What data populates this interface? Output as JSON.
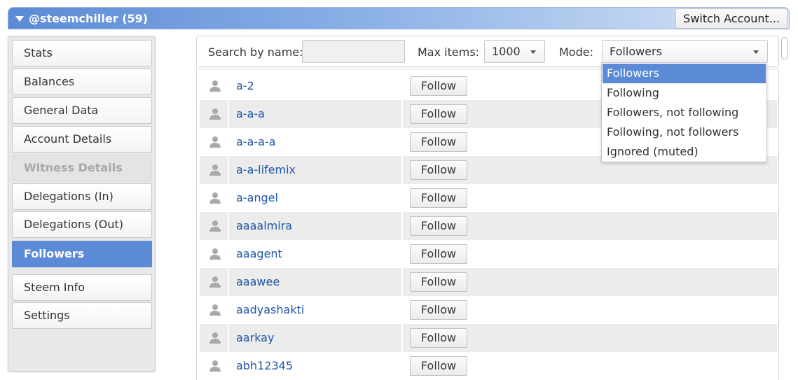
{
  "header": {
    "title": "@steemchiller (59)",
    "switch_label": "Switch Account..."
  },
  "sidebar": {
    "items": [
      {
        "label": "Stats",
        "state": "normal"
      },
      {
        "label": "Balances",
        "state": "normal"
      },
      {
        "label": "General Data",
        "state": "normal"
      },
      {
        "label": "Account Details",
        "state": "normal"
      },
      {
        "label": "Witness Details",
        "state": "disabled"
      },
      {
        "label": "Delegations (In)",
        "state": "normal"
      },
      {
        "label": "Delegations (Out)",
        "state": "normal"
      },
      {
        "label": "Followers",
        "state": "active"
      },
      {
        "label": "Steem Info",
        "state": "normal"
      },
      {
        "label": "Settings",
        "state": "normal"
      }
    ]
  },
  "toolbar": {
    "search_label": "Search by name:",
    "search_value": "",
    "max_label": "Max items:",
    "max_value": "1000",
    "mode_label": "Mode:",
    "mode_value": "Followers"
  },
  "mode_options": [
    {
      "label": "Followers",
      "selected": true
    },
    {
      "label": "Following",
      "selected": false
    },
    {
      "label": "Followers, not following",
      "selected": false
    },
    {
      "label": "Following, not followers",
      "selected": false
    },
    {
      "label": "Ignored (muted)",
      "selected": false
    }
  ],
  "followers": {
    "button_label": "Follow",
    "rows": [
      "a-2",
      "a-a-a",
      "a-a-a-a",
      "a-a-lifemix",
      "a-angel",
      "aaaalmira",
      "aaagent",
      "aaawee",
      "aadyashakti",
      "aarkay",
      "abh12345"
    ]
  },
  "colors": {
    "accent": "#5b8ad6",
    "link": "#1f55a8"
  }
}
